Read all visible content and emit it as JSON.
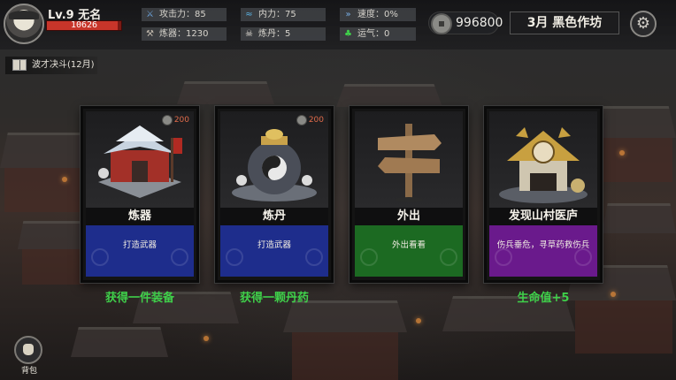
{
  "player": {
    "level_name": "Lv.9 无名",
    "hp": "10626",
    "hp_fraction": 0.95
  },
  "stats": [
    {
      "icon": "sword-icon",
      "label": "攻击力：85",
      "color": "#6aa0d8"
    },
    {
      "icon": "water-icon",
      "label": "内力：75",
      "color": "#5ab0e0"
    },
    {
      "icon": "speed-icon",
      "label": "速度：0%",
      "color": "#7ab0e8"
    },
    {
      "icon": "hammer-icon",
      "label": "炼器：1230",
      "color": "#c0b8ac"
    },
    {
      "icon": "skull-icon",
      "label": "炼丹：5",
      "color": "#e0dcd4"
    },
    {
      "icon": "clover-icon",
      "label": "运气：0",
      "color": "#3fd04a"
    }
  ],
  "currency": {
    "icon": "coin-icon",
    "value": "996800"
  },
  "date_label": "3月 黑色作坊",
  "quest": {
    "icon": "book-icon",
    "label": "波才决斗(12月)"
  },
  "cards": [
    {
      "title": "炼器",
      "desc": "打造武器",
      "cost": "200",
      "has_cost": true,
      "color": "#1e2d8c",
      "reward": "获得一件装备"
    },
    {
      "title": "炼丹",
      "desc": "打造武器",
      "cost": "200",
      "has_cost": true,
      "color": "#1e2d8c",
      "reward": "获得一颗丹药"
    },
    {
      "title": "外出",
      "desc": "外出看看",
      "cost": "",
      "has_cost": false,
      "color": "#1c6a22",
      "reward": ""
    },
    {
      "title": "发现山村医庐",
      "desc": "伤兵垂危，寻草药救伤兵",
      "cost": "",
      "has_cost": false,
      "color": "#6a1a8c",
      "reward": "生命值+5"
    }
  ],
  "backpack_label": "背包",
  "colors": {
    "reward": "#3fd04a",
    "hp": "#c8352a",
    "cost": "#e06b4a"
  }
}
